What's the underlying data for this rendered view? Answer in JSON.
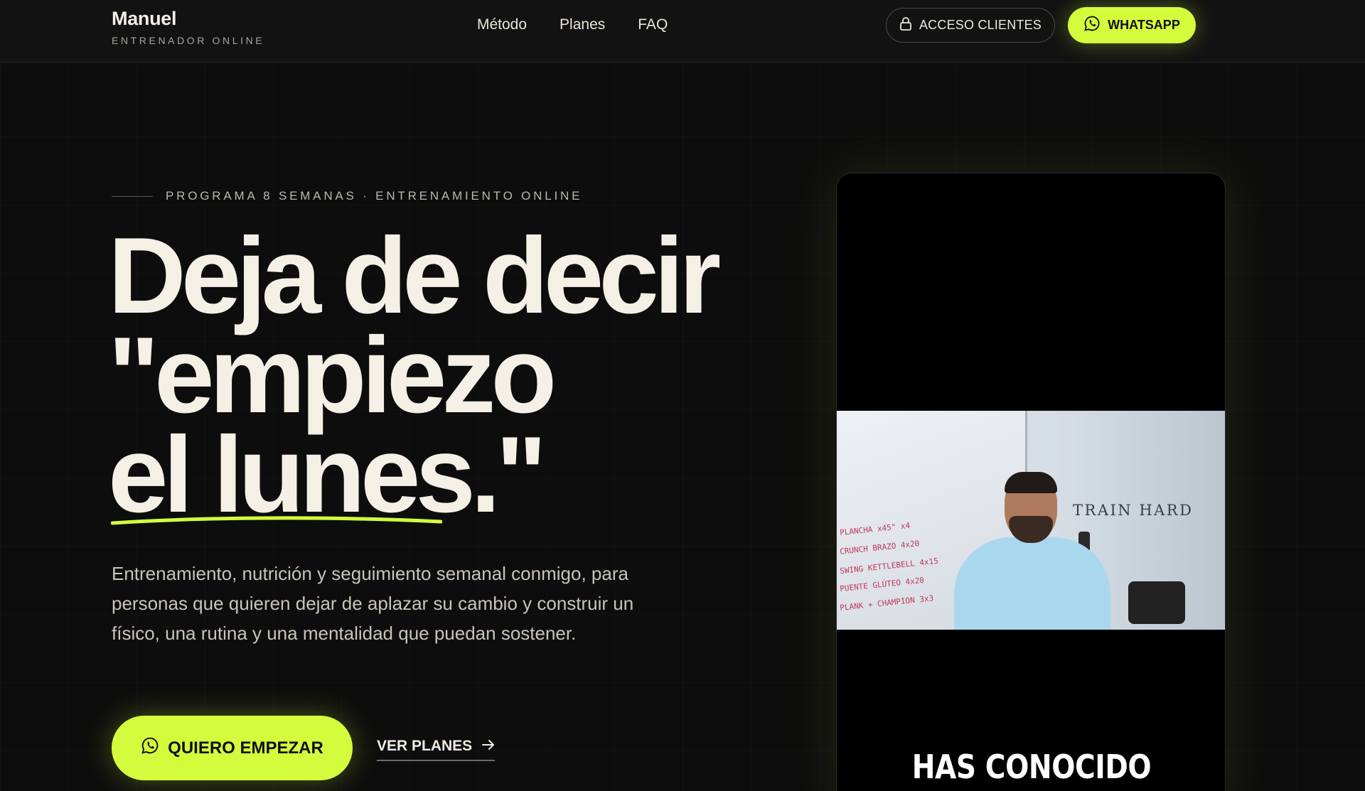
{
  "nav": {
    "brand_name": "Manuel",
    "brand_sub": "ENTRENADOR ONLINE",
    "links": [
      "Método",
      "Planes",
      "FAQ"
    ],
    "acceso_label": "ACCESO CLIENTES",
    "whatsapp_label": "WHATSAPP"
  },
  "hero": {
    "eyebrow": "PROGRAMA 8 SEMANAS · ENTRENAMIENTO ONLINE",
    "headline": [
      "Deja de decir",
      "\"empiezo",
      "el lunes.\""
    ],
    "subtitle": "Entrenamiento, nutrición y seguimiento semanal conmigo, para personas que quieren dejar de aplazar su cambio y construir un físico, una rutina y una mentalidad que puedan sostener.",
    "cta_label": "QUIERO EMPEZAR",
    "secondary_label": "VER PLANES"
  },
  "video": {
    "wall_text": "TRAIN   HARD",
    "caption": "HAS CONOCIDO ALGUNA",
    "whiteboard_lines": [
      "PLANCHA x45\" x4",
      "CRUNCH BRAZO 4x20",
      "SWING KETTLEBELL 4x15",
      "PUENTE GLÚTEO 4x20",
      "PLANK + CHAMPION 3x3"
    ]
  },
  "colors": {
    "accent": "#d4fc3c",
    "background": "#0d0d0d",
    "text": "#f3efe7"
  },
  "icons": {
    "lock": "lock-icon",
    "whatsapp": "whatsapp-icon",
    "arrow": "arrow-right-icon"
  }
}
